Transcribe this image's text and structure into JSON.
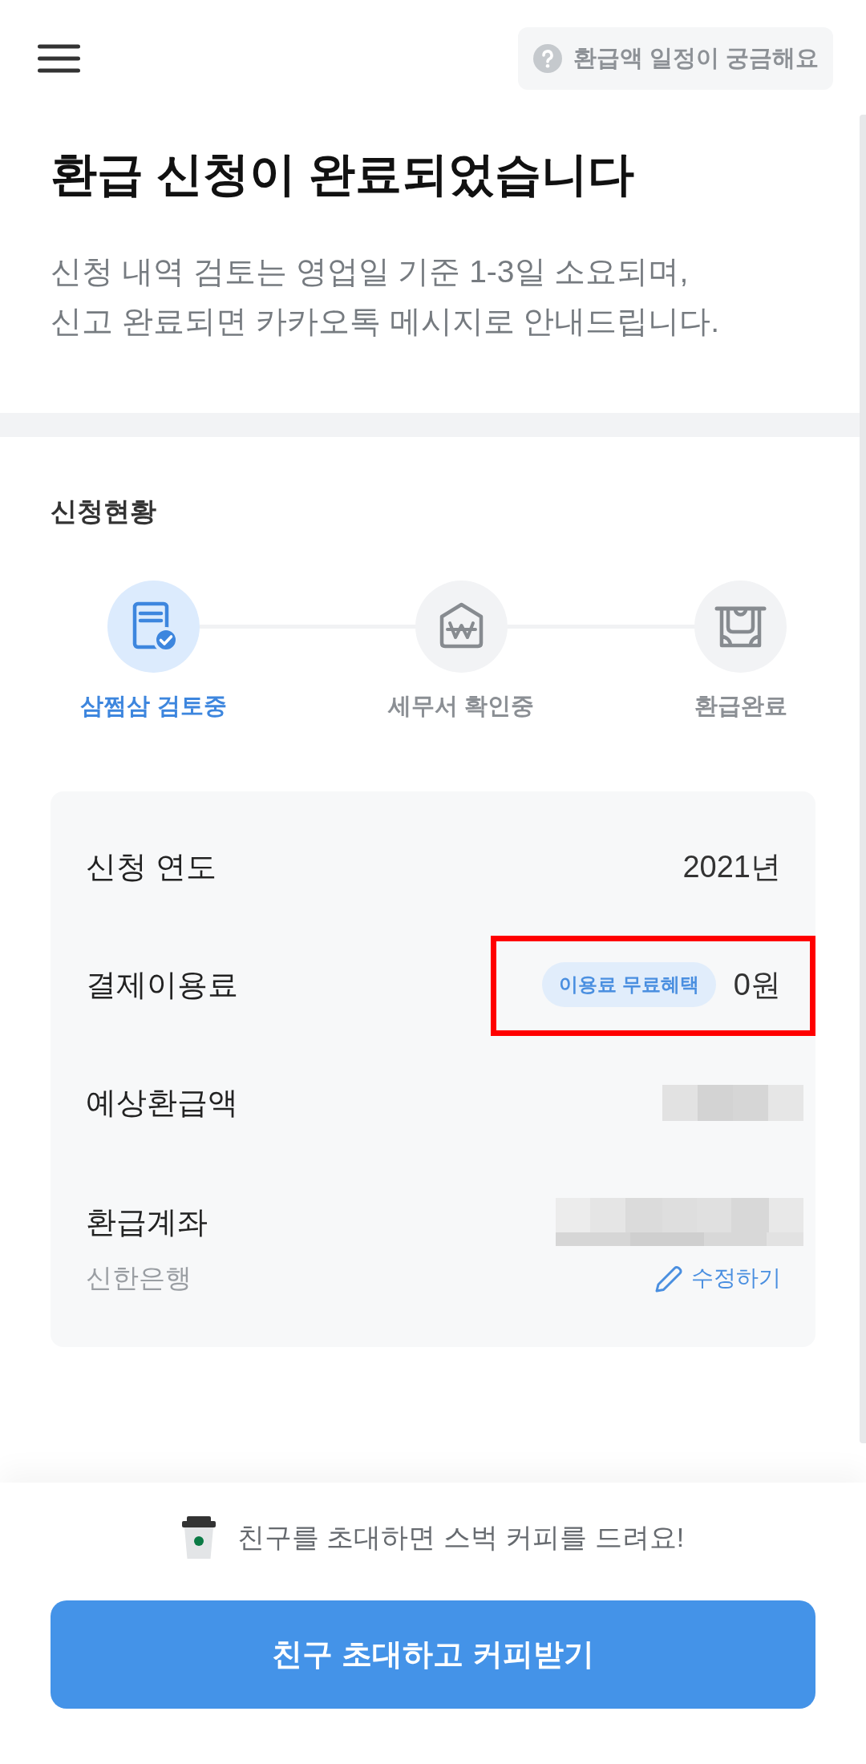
{
  "header": {
    "help_button": "환급액 일정이 궁금해요"
  },
  "intro": {
    "title": "환급 신청이 완료되었습니다",
    "description": [
      "신청 내역 검토는 영업일 기준 1-3일 소요되며,",
      "신고 완료되면 카카오톡 메시지로 안내드립니다."
    ]
  },
  "status": {
    "heading": "신청현황",
    "steps": [
      {
        "label": "삼쩜삼 검토중",
        "current": true
      },
      {
        "label": "세무서 확인중",
        "current": false
      },
      {
        "label": "환급완료",
        "current": false
      }
    ]
  },
  "details": {
    "rows": [
      {
        "kind": "plain",
        "label": "신청 연도",
        "value": "2021년",
        "highlighted": false
      },
      {
        "kind": "badge",
        "label": "결제이용료",
        "badge": "이용료 무료혜택",
        "value": "0원",
        "highlighted": true
      },
      {
        "kind": "blurred",
        "label": "예상환급액",
        "highlighted": false
      },
      {
        "kind": "account",
        "label": "환급계좌",
        "bank": "신한은행",
        "edit_link": "수정하기",
        "highlighted": false
      }
    ]
  },
  "invite": {
    "message": "친구를 초대하면 스벅 커피를 드려요!",
    "button": "친구 초대하고 커피받기"
  }
}
